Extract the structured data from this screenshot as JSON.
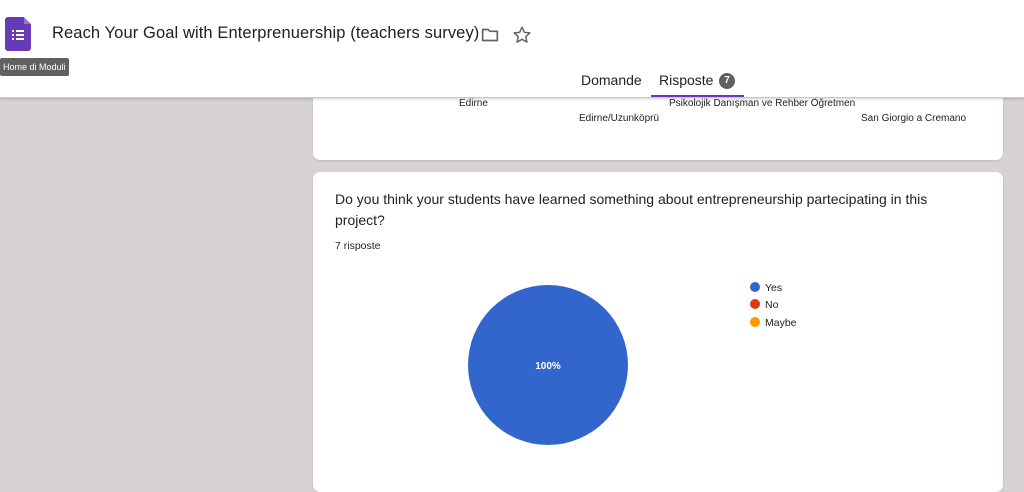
{
  "header": {
    "title": "Reach Your Goal with Enterprenuership (teachers survey)",
    "home_tooltip": "Home di Moduli",
    "icons": {
      "app": "forms-icon",
      "folder": "folder-icon",
      "star": "star-icon"
    },
    "brand_color": "#673ab7"
  },
  "tabs": {
    "questions_label": "Domande",
    "responses_label": "Risposte",
    "responses_count": "7",
    "active": "Risposte"
  },
  "word_cloud": {
    "words": [
      "Edirne",
      "Psikolojik Danışman ve Rehber Öğretmen",
      "Edirne/Uzunköprü",
      "San Giorgio a Cremano"
    ]
  },
  "question_card": {
    "question": "Do you think your students have learned something about entrepreneurship partecipating in this project?",
    "response_count": "7 risposte"
  },
  "chart_data": {
    "type": "pie",
    "categories": [
      "Yes",
      "No",
      "Maybe"
    ],
    "values": [
      100,
      0,
      0
    ],
    "labels": [
      "100%"
    ],
    "colors": [
      "#3366cc",
      "#dc3912",
      "#ff9900"
    ],
    "legend_position": "right"
  }
}
